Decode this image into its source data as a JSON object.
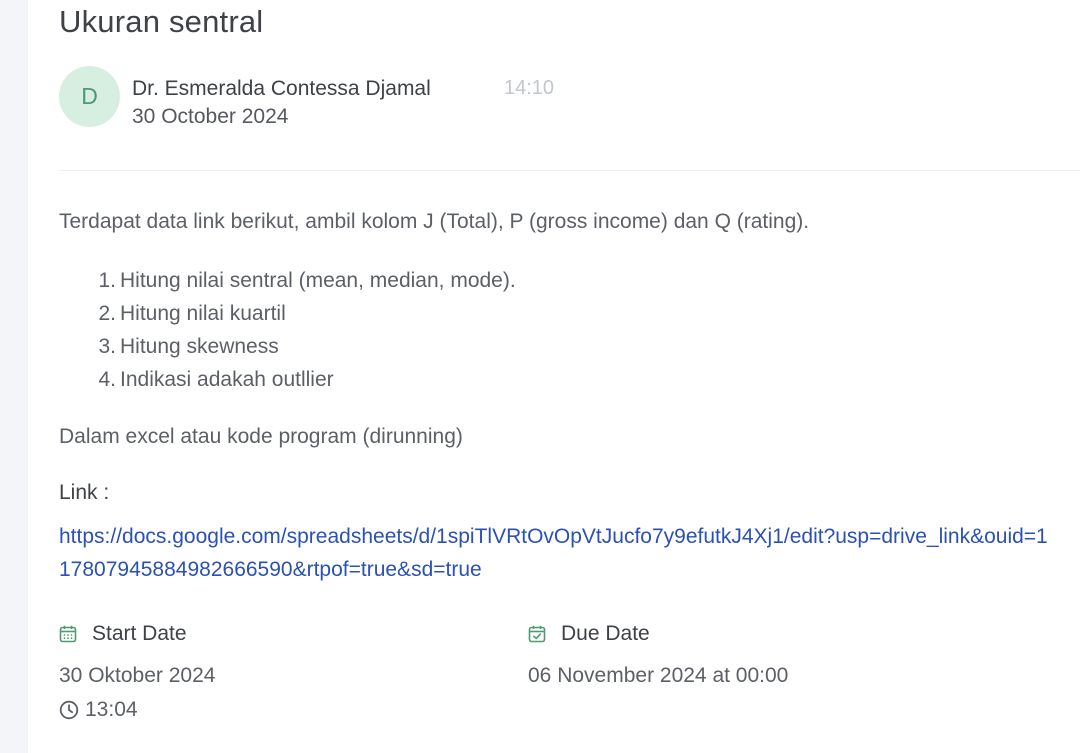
{
  "post": {
    "title": "Ukuran sentral",
    "author_initial": "D",
    "author_name": "Dr. Esmeralda Contessa Djamal",
    "time": "14:10",
    "date": "30 October 2024"
  },
  "body": {
    "intro": "Terdapat data link berikut, ambil kolom J (Total), P (gross income) dan Q (rating).",
    "tasks": [
      {
        "num": "1.",
        "text": "Hitung nilai sentral (mean, median, mode)."
      },
      {
        "num": "2.",
        "text": "Hitung nilai kuartil"
      },
      {
        "num": "3.",
        "text": "Hitung skewness"
      },
      {
        "num": "4.",
        "text": "Indikasi adakah outllier"
      }
    ],
    "note": "Dalam excel atau kode program (dirunning)",
    "link_label": "Link :",
    "link_url": "https://docs.google.com/spreadsheets/d/1spiTlVRtOvOpVtJucfo7y9efutkJ4Xj1/edit?usp=drive_link&ouid=117807945884982666590&rtpof=true&sd=true"
  },
  "schedule": {
    "start_label": "Start Date",
    "start_date": "30 Oktober 2024",
    "start_time": "13:04",
    "due_label": "Due Date",
    "due_date": "06 November 2024 at 00:00"
  },
  "colors": {
    "accent_green": "#4e9a74",
    "link_blue": "#2b51b5",
    "avatar_bg": "#d6efe1"
  },
  "icons": [
    "calendar-icon",
    "calendar-check-icon",
    "clock-icon"
  ]
}
